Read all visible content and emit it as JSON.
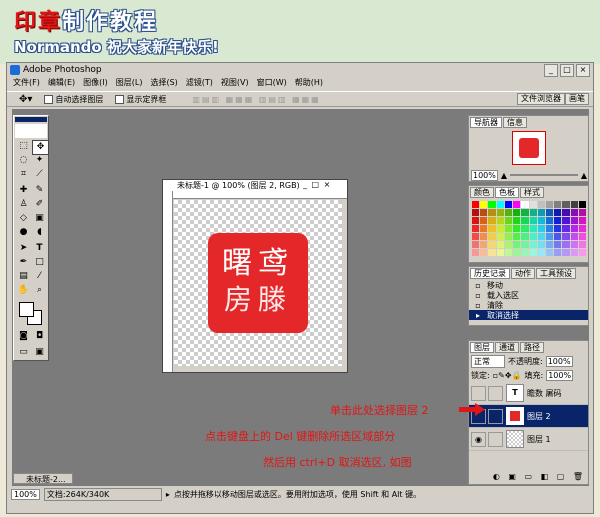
{
  "tutorial": {
    "title_red": "印章",
    "title_rest": "制作教程",
    "subtitle": "Normando 祝大家新年快乐!"
  },
  "app": {
    "title": "Adobe Photoshop",
    "menu": [
      "文件(F)",
      "编辑(E)",
      "图像(I)",
      "图层(L)",
      "选择(S)",
      "滤镜(T)",
      "视图(V)",
      "窗口(W)",
      "帮助(H)"
    ],
    "options": {
      "auto_select": "自动选择图层",
      "show_bounds": "显示定界框"
    },
    "palette_tabs": [
      "文件浏览器",
      "画笔"
    ]
  },
  "document": {
    "title": "未标题-1 @ 100% (图层 2, RGB)",
    "seal_text": "曙鸢",
    "zoom": "100%"
  },
  "navigator": {
    "tabs": [
      "导航器",
      "信息"
    ],
    "zoom": "100%"
  },
  "color_panel": {
    "tabs": [
      "颜色",
      "色板",
      "样式"
    ]
  },
  "history": {
    "tabs": [
      "历史记录",
      "动作",
      "工具预设"
    ],
    "items": [
      "移动",
      "载入选区",
      "清除",
      "取消选择"
    ]
  },
  "layers": {
    "tabs": [
      "图层",
      "通道",
      "路径"
    ],
    "blend_mode": "正常",
    "opacity_label": "不透明度:",
    "opacity": "100%",
    "lock_label": "锁定:",
    "fill_label": "填充:",
    "fill": "100%",
    "items": [
      {
        "name": "瞻数 屠码",
        "kind": "T"
      },
      {
        "name": "图层 2",
        "kind": "seal"
      },
      {
        "name": "图层 1",
        "kind": "plain"
      }
    ]
  },
  "status": {
    "zoom": "100%",
    "doc_info": "文档:264K/340K",
    "hint": "点按并拖移以移动图层或选区。要用附加选项，使用 Shift 和 Alt 键。"
  },
  "minimized": {
    "label": "未标题-2..."
  },
  "annotations": {
    "line1": "单击此处选择图层 2",
    "line2": "点击键盘上的 Del 键删除所选区域部分",
    "line3": "然后用 ctrl+D 取消选区, 如图"
  },
  "colors": {
    "seal_red": "#e4282a",
    "panel_blue": "#0a246a",
    "workspace_gray": "#7c7b7b",
    "annotation_red": "#e01515"
  }
}
